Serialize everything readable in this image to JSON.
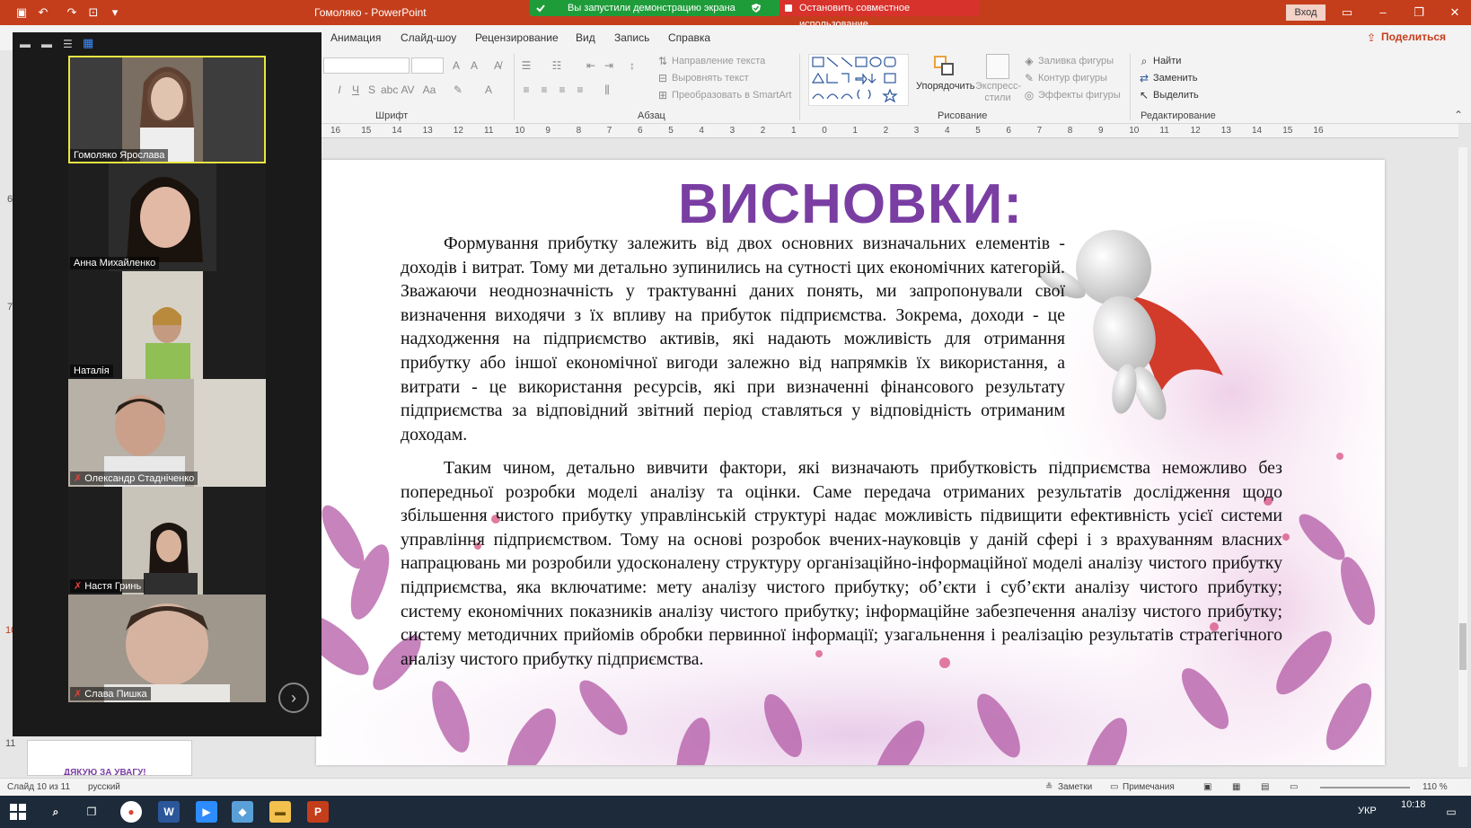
{
  "window": {
    "title": "Гомоляко - PowerPoint",
    "login": "Вход",
    "share_banner": "Вы запустили демонстрацию экрана",
    "stop_share": "Остановить совместное использование"
  },
  "ribbon": {
    "tabs": [
      "Анимация",
      "Слайд-шоу",
      "Рецензирование",
      "Вид",
      "Запись",
      "Справка"
    ],
    "share": "Поделиться",
    "groups": [
      "Шрифт",
      "Абзац",
      "Рисование",
      "Редактирование"
    ],
    "paragraph": {
      "text_direction": "Направление текста",
      "align_text": "Выровнять текст",
      "convert_smartart": "Преобразовать в SmartArt"
    },
    "drawing": {
      "arrange": "Упорядочить",
      "quick_styles": "Экспресс-стили",
      "fill": "Заливка фигуры",
      "outline": "Контур фигуры",
      "effects": "Эффекты фигуры"
    },
    "editing": {
      "find": "Найти",
      "replace": "Заменить",
      "select": "Выделить"
    }
  },
  "ruler": [
    "16",
    "15",
    "14",
    "13",
    "12",
    "11",
    "10",
    "9",
    "8",
    "7",
    "6",
    "5",
    "4",
    "3",
    "2",
    "1",
    "0",
    "1",
    "2",
    "3",
    "4",
    "5",
    "6",
    "7",
    "8",
    "9",
    "10",
    "11",
    "12",
    "13",
    "14",
    "15",
    "16"
  ],
  "slide": {
    "title": "ВИСНОВКИ:",
    "paragraph1": "Формування прибутку залежить від двох основних визначальних елементів - доходів і витрат. Тому ми детально зупинились на сутності цих економічних категорій. Зважаючи неоднозначність у трактуванні даних понять, ми запропонували свої визначення виходячи з їх впливу на прибуток підприємства. Зокрема, доходи - це надходження на підприємство активів, які надають можливість для отримання прибутку або іншої економічної вигоди залежно від напрямків їх використання, а витрати - це використання ресурсів, які при визначенні фінансового результату підприємства за відповідний звітний період ставляться у відповідність отриманим доходам.",
    "paragraph2": "Таким чином, детально вивчити фактори, які визначають прибутковість підприємства неможливо без попередньої розробки моделі аналізу та оцінки. Саме передача отриманих результатів дослідження щодо збільшення чистого прибутку управлінській структурі надає можливість підвищити ефективність усієї системи управління підприємством. Тому на основі розробок вчених-науковців у даній сфері і з врахуванням власних напрацювань ми розробили удосконалену структуру організаційно-інформаційної моделі аналізу чистого прибутку підприємства, яка включатиме: мету аналізу чистого прибутку; об’єкти і суб’єкти аналізу чистого прибутку; систему економічних показників аналізу чистого прибутку; інформаційне забезпечення аналізу чистого прибутку; систему методичних прийомів обробки первинної інформації; узагальнення і реалізацію результатів стратегічного аналізу чистого прибутку підприємства."
  },
  "thumbnails": {
    "numbers": [
      "6",
      "7",
      "10",
      "11"
    ],
    "next_slide_text": "ДЯКУЮ ЗА УВАГУ!"
  },
  "participants": [
    {
      "name": "Гомоляко Ярослава",
      "muted": false,
      "active": true
    },
    {
      "name": "Анна Михайленко",
      "muted": false,
      "active": false
    },
    {
      "name": "Наталія",
      "muted": false,
      "active": false
    },
    {
      "name": "Олександр Стадніченко",
      "muted": true,
      "active": false
    },
    {
      "name": "Настя Гринь",
      "muted": true,
      "active": false
    },
    {
      "name": "Слава Пишка",
      "muted": true,
      "active": false
    }
  ],
  "status": {
    "slide_info": "Слайд 10 из 11",
    "language": "русский",
    "notes": "Заметки",
    "comments": "Примечания",
    "zoom": "110 %"
  },
  "taskbar": {
    "lang": "УКР",
    "time": "10:18"
  }
}
